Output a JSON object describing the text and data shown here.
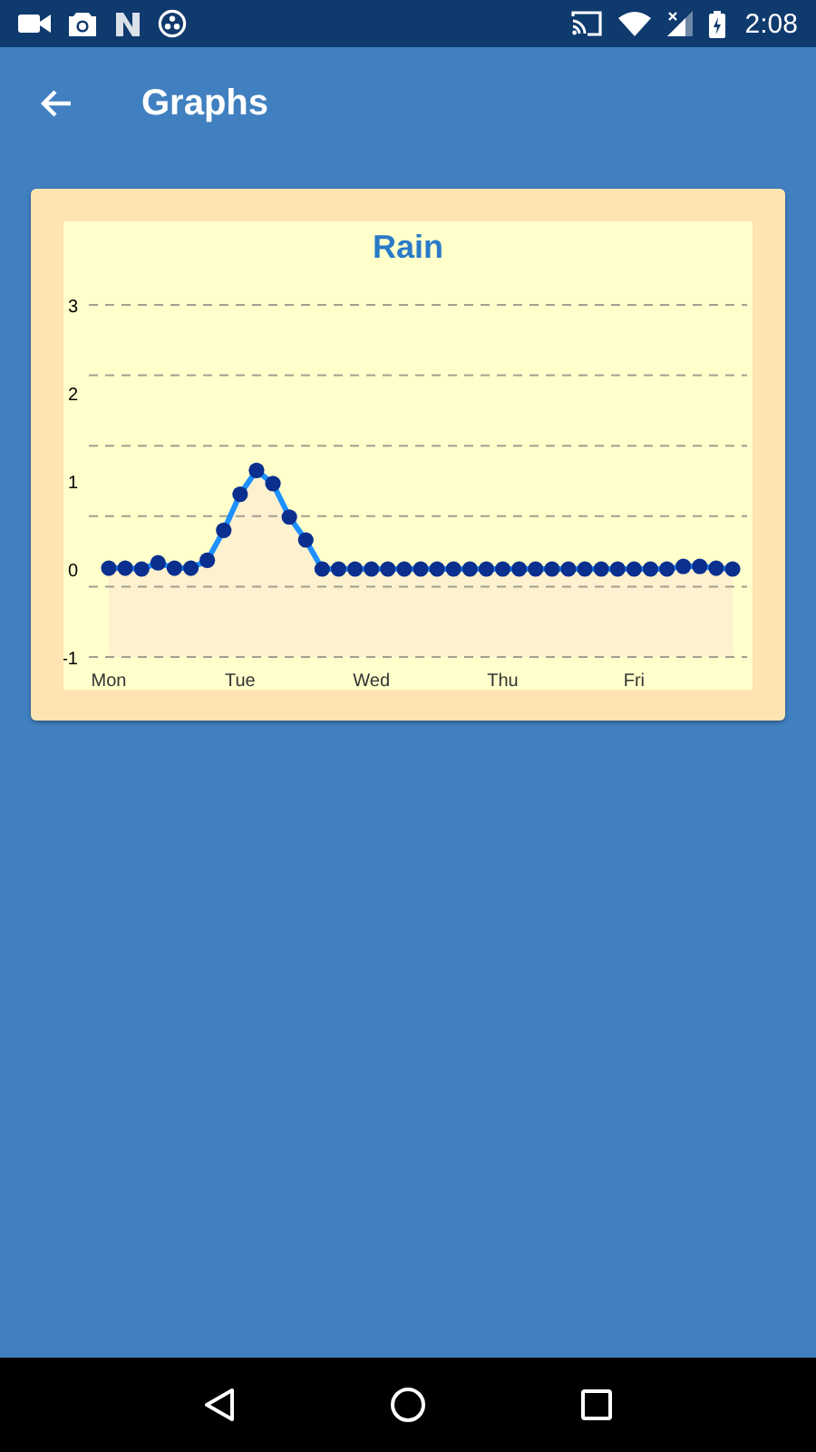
{
  "status_bar": {
    "time": "2:08"
  },
  "app_bar": {
    "title": "Graphs"
  },
  "card": {
    "chart_data": {
      "type": "line",
      "title": "Rain",
      "categories": [
        "Mon",
        null,
        null,
        null,
        null,
        null,
        null,
        null,
        "Tue",
        null,
        null,
        null,
        null,
        null,
        null,
        null,
        "Wed",
        null,
        null,
        null,
        null,
        null,
        null,
        null,
        "Thu",
        null,
        null,
        null,
        null,
        null,
        null,
        null,
        "Fri",
        null,
        null,
        null,
        null,
        null,
        null
      ],
      "series": [
        {
          "color": "#1e90ff",
          "marker": "circle",
          "values": [
            0.01,
            0.01,
            0,
            0.07,
            0.01,
            0.01,
            0.1,
            0.44,
            0.85,
            1.12,
            0.97,
            0.59,
            0.33,
            0,
            0,
            0,
            0,
            0,
            0,
            0,
            0,
            0,
            0,
            0,
            0,
            0,
            0,
            0,
            0,
            0,
            0,
            0,
            0,
            0,
            0,
            0.03,
            0.03,
            0.01,
            0
          ]
        }
      ],
      "ylim": [
        -1,
        3
      ],
      "yticks": [
        -1,
        0,
        1,
        2,
        3
      ]
    }
  }
}
